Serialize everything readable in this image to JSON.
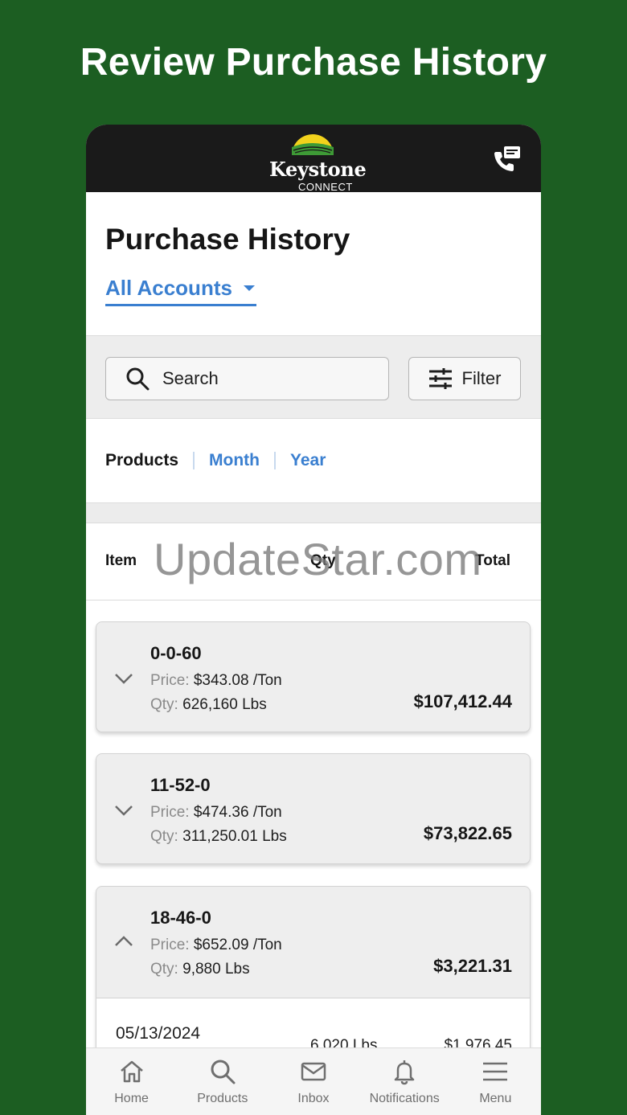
{
  "promo": {
    "title": "Review Purchase History"
  },
  "header": {
    "logo_name": "Keystone",
    "logo_sub": "CONNECT",
    "contact_icon": "phone-message-icon"
  },
  "page": {
    "title": "Purchase History",
    "account_filter": "All Accounts"
  },
  "toolbar": {
    "search_label": "Search",
    "filter_label": "Filter"
  },
  "tabs": [
    {
      "label": "Products",
      "active": true
    },
    {
      "label": "Month",
      "active": false
    },
    {
      "label": "Year",
      "active": false
    }
  ],
  "columns": {
    "item": "Item",
    "qty": "Qty",
    "total": "Total"
  },
  "watermark": "UpdateStar.com",
  "items": [
    {
      "name": "0-0-60",
      "price_label": "Price:",
      "price": "$343.08 /Ton",
      "qty_label": "Qty:",
      "qty": "626,160 Lbs",
      "total": "$107,412.44",
      "expanded": false
    },
    {
      "name": "11-52-0",
      "price_label": "Price:",
      "price": "$474.36 /Ton",
      "qty_label": "Qty:",
      "qty": "311,250.01 Lbs",
      "total": "$73,822.65",
      "expanded": false
    },
    {
      "name": "18-46-0",
      "price_label": "Price:",
      "price": "$652.09 /Ton",
      "qty_label": "Qty:",
      "qty": "9,880 Lbs",
      "total": "$3,221.31",
      "expanded": true,
      "detail": {
        "date": "05/13/2024",
        "qty": "6,020 Lbs",
        "total": "$1,976.45"
      }
    }
  ],
  "nav": [
    {
      "label": "Home",
      "icon": "home-icon"
    },
    {
      "label": "Products",
      "icon": "search-icon"
    },
    {
      "label": "Inbox",
      "icon": "mail-icon"
    },
    {
      "label": "Notifications",
      "icon": "bell-icon"
    },
    {
      "label": "Menu",
      "icon": "menu-icon"
    }
  ],
  "colors": {
    "background": "#1c5e22",
    "accent": "#3a7fd0",
    "header": "#1a1a1a"
  }
}
